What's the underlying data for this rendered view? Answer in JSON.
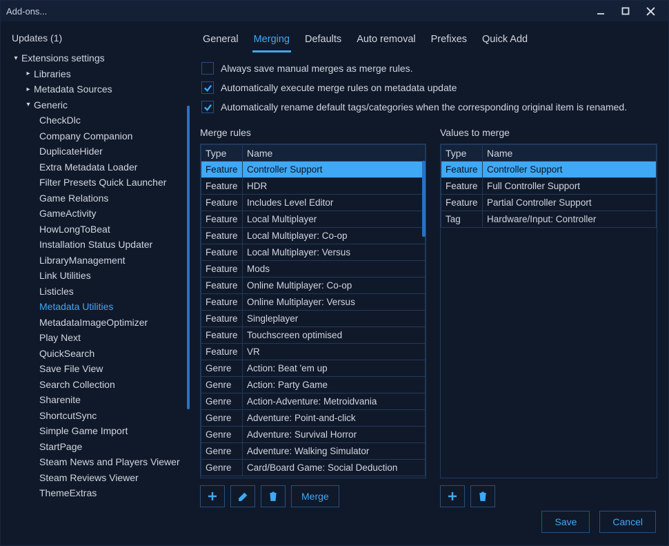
{
  "window": {
    "title": "Add-ons..."
  },
  "sidebar": {
    "updates_label": "Updates (1)",
    "root": {
      "label": "Extensions settings",
      "children": [
        {
          "label": "Libraries",
          "expanded": false
        },
        {
          "label": "Metadata Sources",
          "expanded": false
        },
        {
          "label": "Generic",
          "expanded": true,
          "children": [
            "CheckDlc",
            "Company Companion",
            "DuplicateHider",
            "Extra Metadata Loader",
            "Filter Presets Quick Launcher",
            "Game Relations",
            "GameActivity",
            "HowLongToBeat",
            "Installation Status Updater",
            "LibraryManagement",
            "Link Utilities",
            "Listicles",
            "Metadata Utilities",
            "MetadataImageOptimizer",
            "Play Next",
            "QuickSearch",
            "Save File View",
            "Search Collection",
            "Sharenite",
            "ShortcutSync",
            "Simple Game Import",
            "StartPage",
            "Steam News and Players Viewer",
            "Steam Reviews Viewer",
            "ThemeExtras"
          ]
        }
      ]
    },
    "selected": "Metadata Utilities"
  },
  "tabs": [
    "General",
    "Merging",
    "Defaults",
    "Auto removal",
    "Prefixes",
    "Quick Add"
  ],
  "active_tab": "Merging",
  "checkboxes": [
    {
      "label": "Always save manual merges as merge rules.",
      "checked": false
    },
    {
      "label": "Automatically execute merge rules on metadata update",
      "checked": true
    },
    {
      "label": "Automatically rename default tags/categories when the corresponding original item is renamed.",
      "checked": true
    }
  ],
  "merge_rules": {
    "title": "Merge rules",
    "columns": [
      "Type",
      "Name"
    ],
    "rows": [
      {
        "type": "Feature",
        "name": "Controller Support",
        "selected": true
      },
      {
        "type": "Feature",
        "name": "HDR"
      },
      {
        "type": "Feature",
        "name": "Includes Level Editor"
      },
      {
        "type": "Feature",
        "name": "Local Multiplayer"
      },
      {
        "type": "Feature",
        "name": "Local Multiplayer: Co-op"
      },
      {
        "type": "Feature",
        "name": "Local Multiplayer: Versus"
      },
      {
        "type": "Feature",
        "name": "Mods"
      },
      {
        "type": "Feature",
        "name": "Online Multiplayer: Co-op"
      },
      {
        "type": "Feature",
        "name": "Online Multiplayer: Versus"
      },
      {
        "type": "Feature",
        "name": "Singleplayer"
      },
      {
        "type": "Feature",
        "name": "Touchscreen optimised"
      },
      {
        "type": "Feature",
        "name": "VR"
      },
      {
        "type": "Genre",
        "name": "Action: Beat 'em up"
      },
      {
        "type": "Genre",
        "name": "Action: Party Game"
      },
      {
        "type": "Genre",
        "name": "Action-Adventure: Metroidvania"
      },
      {
        "type": "Genre",
        "name": "Adventure: Point-and-click"
      },
      {
        "type": "Genre",
        "name": "Adventure: Survival Horror"
      },
      {
        "type": "Genre",
        "name": "Adventure: Walking Simulator"
      },
      {
        "type": "Genre",
        "name": "Card/Board Game: Social Deduction"
      }
    ],
    "buttons": {
      "merge": "Merge"
    }
  },
  "values_to_merge": {
    "title": "Values to merge",
    "columns": [
      "Type",
      "Name"
    ],
    "rows": [
      {
        "type": "Feature",
        "name": "Controller Support",
        "selected": true
      },
      {
        "type": "Feature",
        "name": "Full Controller Support"
      },
      {
        "type": "Feature",
        "name": "Partial Controller Support"
      },
      {
        "type": "Tag",
        "name": "Hardware/Input: Controller"
      }
    ]
  },
  "footer": {
    "save": "Save",
    "cancel": "Cancel"
  }
}
